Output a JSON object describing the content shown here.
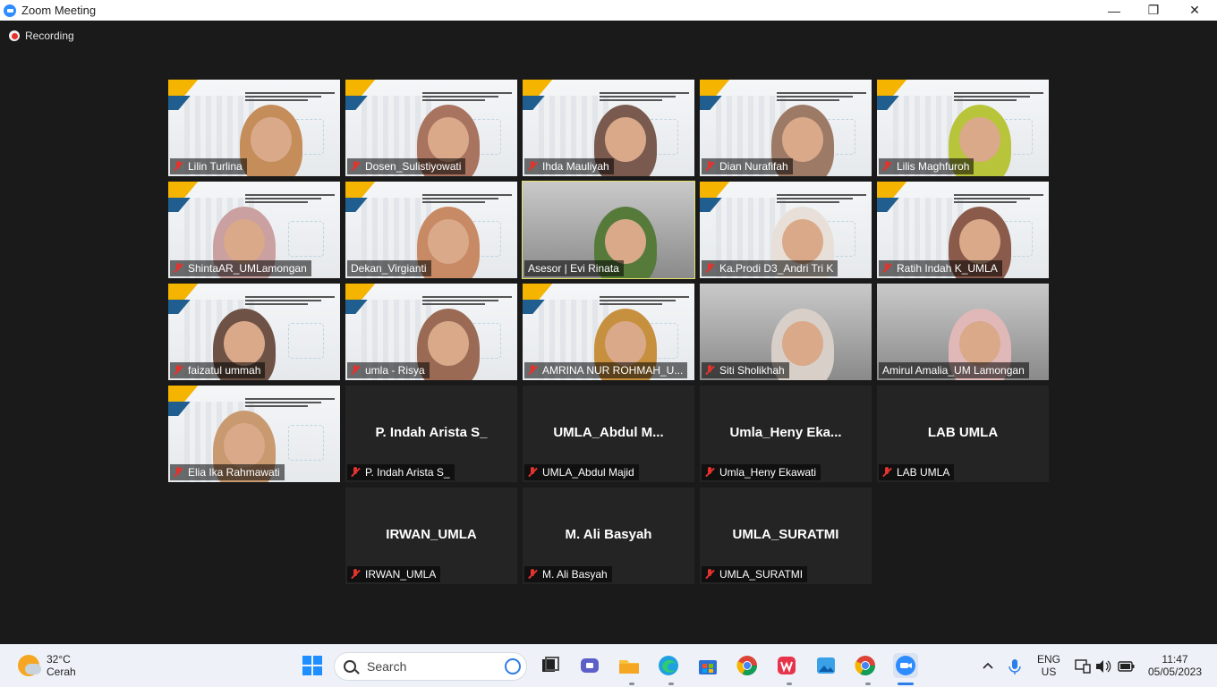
{
  "window": {
    "title": "Zoom Meeting",
    "minimize_glyph": "—",
    "maximize_glyph": "❐",
    "close_glyph": "✕"
  },
  "recording": {
    "label": "Recording"
  },
  "participants": [
    {
      "name": "Lilin Turlina",
      "video": true,
      "muted": true
    },
    {
      "name": "Dosen_Sulistiyowati",
      "video": true,
      "muted": true
    },
    {
      "name": "Ihda Mauliyah",
      "video": true,
      "muted": true
    },
    {
      "name": "Dian Nurafifah",
      "video": true,
      "muted": true
    },
    {
      "name": "Lilis Maghfuroh",
      "video": true,
      "muted": true
    },
    {
      "name": "ShintaAR_UMLamongan",
      "video": true,
      "muted": true
    },
    {
      "name": "Dekan_Virgianti",
      "video": true,
      "muted": false
    },
    {
      "name": "Asesor | Evi Rinata",
      "video": true,
      "muted": false,
      "active_speaker": true
    },
    {
      "name": "Ka.Prodi D3_Andri Tri K",
      "video": true,
      "muted": true
    },
    {
      "name": "Ratih Indah K_UMLA",
      "video": true,
      "muted": true
    },
    {
      "name": "faizatul ummah",
      "video": true,
      "muted": true
    },
    {
      "name": "umla - Risya",
      "video": true,
      "muted": true
    },
    {
      "name": "AMRINA NUR ROHMAH_U...",
      "video": true,
      "muted": true
    },
    {
      "name": "Siti Sholikhah",
      "video": true,
      "muted": true
    },
    {
      "name": "Amirul Amalia_UM Lamongan",
      "video": true,
      "muted": false
    },
    {
      "name": "Elia Ika Rahmawati",
      "video": true,
      "muted": true
    },
    {
      "name": "P. Indah Arista S_",
      "display": "P. Indah Arista S_",
      "video": false,
      "muted": true
    },
    {
      "name": "UMLA_Abdul Majid",
      "display": "UMLA_Abdul  M...",
      "video": false,
      "muted": true
    },
    {
      "name": "Umla_Heny Ekawati",
      "display": "Umla_Heny  Eka...",
      "video": false,
      "muted": true
    },
    {
      "name": "LAB UMLA",
      "display": "LAB UMLA",
      "video": false,
      "muted": true
    },
    {
      "name": "IRWAN_UMLA",
      "display": "IRWAN_UMLA",
      "video": false,
      "muted": true
    },
    {
      "name": "M. Ali Basyah",
      "display": "M. Ali Basyah",
      "video": false,
      "muted": true
    },
    {
      "name": "UMLA_SURATMI",
      "display": "UMLA_SURATMI",
      "video": false,
      "muted": true
    }
  ],
  "taskbar": {
    "weather": {
      "temp": "32°C",
      "condition": "Cerah"
    },
    "search_label": "Search",
    "language": {
      "line1": "ENG",
      "line2": "US"
    },
    "clock": {
      "time": "11:47",
      "date": "05/05/2023"
    },
    "colors": {
      "accent": "#2b7de9"
    },
    "apps": [
      "windows-start-icon",
      "file-explorer-icon",
      "task-view-icon",
      "meet-icon",
      "folder-icon",
      "edge-icon",
      "store-icon",
      "chrome-icon",
      "wps-icon",
      "photos-icon",
      "chrome-icon",
      "zoom-icon"
    ]
  }
}
